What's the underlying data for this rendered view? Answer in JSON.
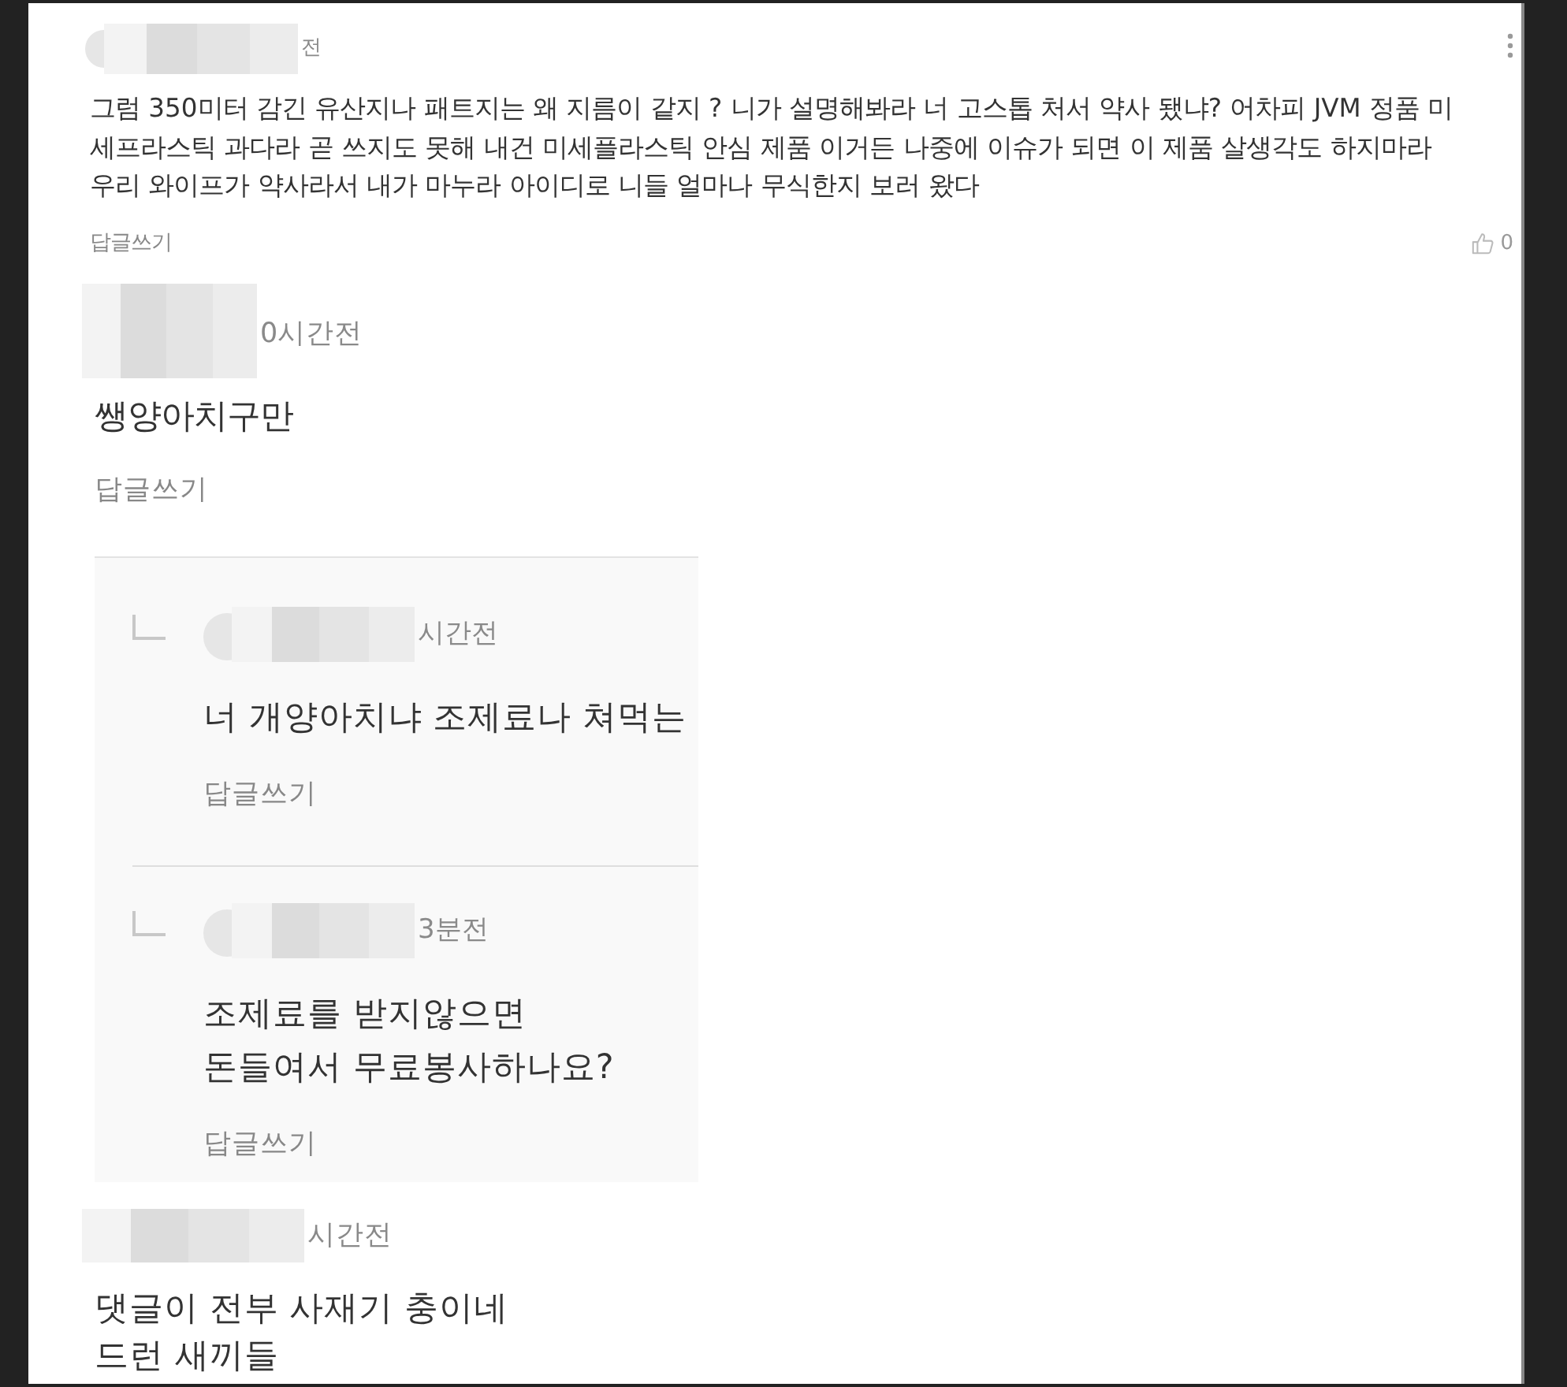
{
  "comments": [
    {
      "kind": "compact",
      "time": "전",
      "menu": true,
      "text": "그럼 350미터 감긴 유산지나 패트지는 왜 지름이 같지 ? 니가 설명해봐라 너 고스톱 처서 약사 됐냐? 어차피 JVM 정품 미세프라스틱 과다라 곧 쓰지도 못해 내건 미세플라스틱 안심 제품 이거든 나중에 이슈가 되면 이 제품 살생각도 하지마라 우리 와이프가 약사라서 내가 마누라 아이디로 니들 얼마나 무식한지 보러 왔다",
      "reply_button": "답글쓰기",
      "likes": "0"
    },
    {
      "kind": "large",
      "time": "0시간전",
      "text": "쌩양아치구만",
      "reply_button": "답글쓰기",
      "replies": [
        {
          "time": "시간전",
          "text": "너 개양아치냐 조제료나 쳐먹는",
          "reply_button": "답글쓰기"
        },
        {
          "time": "3분전",
          "text": "조제료를 받지않으면\n돈들여서 무료봉사하나요?",
          "reply_button": "답글쓰기"
        }
      ]
    },
    {
      "kind": "large",
      "time": "시간전",
      "text": "댓글이 전부 사재기 충이네\n드런 새끼들"
    }
  ]
}
